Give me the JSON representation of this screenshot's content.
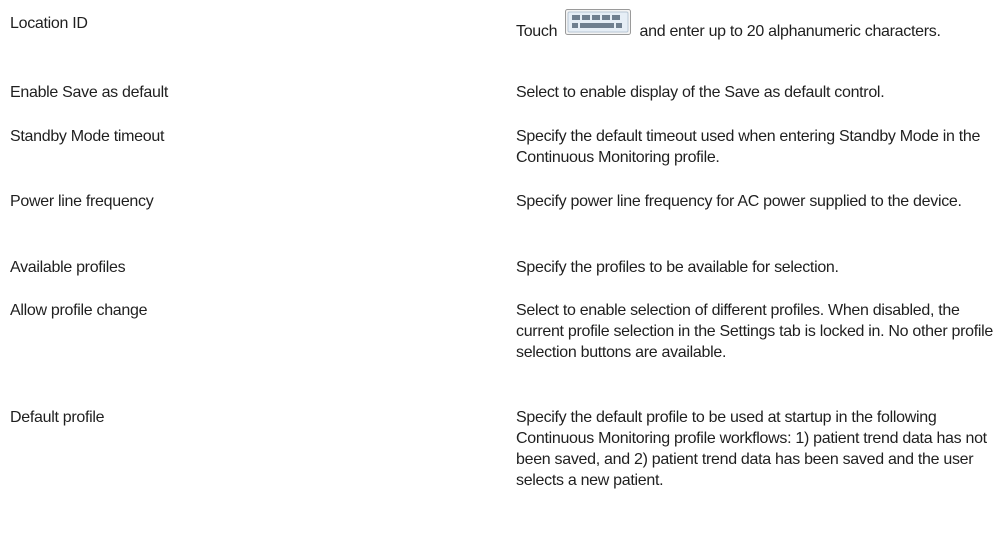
{
  "rows": [
    {
      "setting": "Location ID",
      "desc_prefix": "Touch",
      "desc_icon": "keyboard-icon",
      "desc_suffix": "and enter up to 20 alphanumeric characters."
    },
    {
      "setting": "Enable Save as default",
      "desc": "Select to enable display of the Save as default control."
    },
    {
      "setting": "Standby Mode timeout",
      "desc": "Specify the default timeout used when entering Standby Mode in the Continuous Monitoring profile."
    },
    {
      "setting": "Power line frequency",
      "desc": "Specify power line frequency for AC power supplied to the device."
    },
    {
      "setting": "Available profiles",
      "desc": "Specify the profiles to be available for selection."
    },
    {
      "setting": "Allow profile change",
      "desc": "Select to enable selection of different profiles. When disabled, the current profile selection in the Settings tab is locked in. No other profile selection buttons are available."
    },
    {
      "setting": "Default profile",
      "desc": "Specify the default profile to be used at startup in the following Continuous Monitoring profile workflows: 1) patient trend data has not been saved, and 2) patient trend data has been saved and the user selects a new patient."
    }
  ]
}
